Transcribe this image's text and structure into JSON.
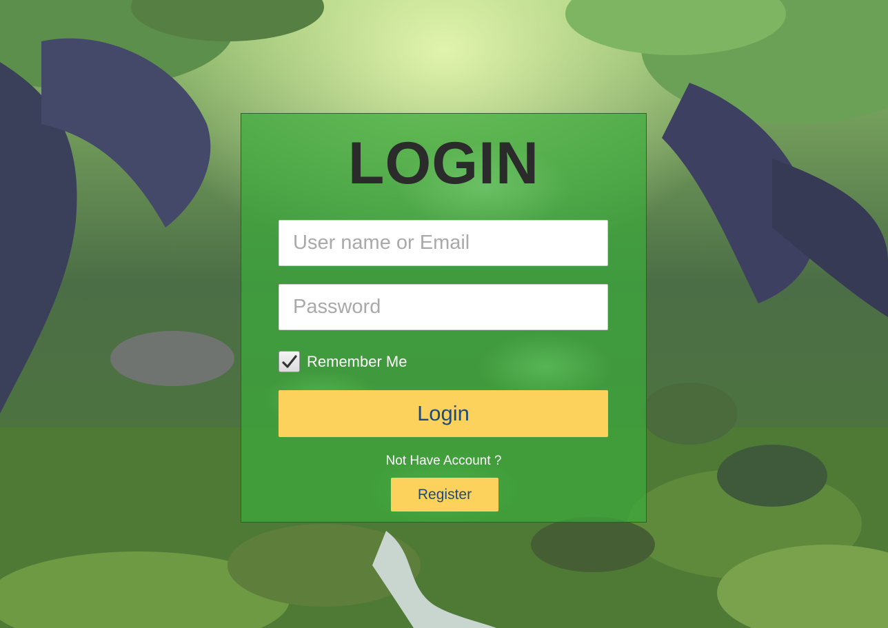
{
  "login": {
    "title": "LOGIN",
    "username_placeholder": "User name or Email",
    "password_placeholder": "Password",
    "remember_label": "Remember Me",
    "remember_checked": true,
    "login_button": "Login",
    "no_account_text": "Not Have Account ?",
    "register_button": "Register"
  },
  "colors": {
    "panel": "#3caa3c",
    "button": "#fcd25c",
    "button_text": "#1f4a7a",
    "title_text": "#2b2b2b"
  },
  "icons": {
    "checkbox": "checkmark-icon",
    "background": "forest-background-image"
  }
}
